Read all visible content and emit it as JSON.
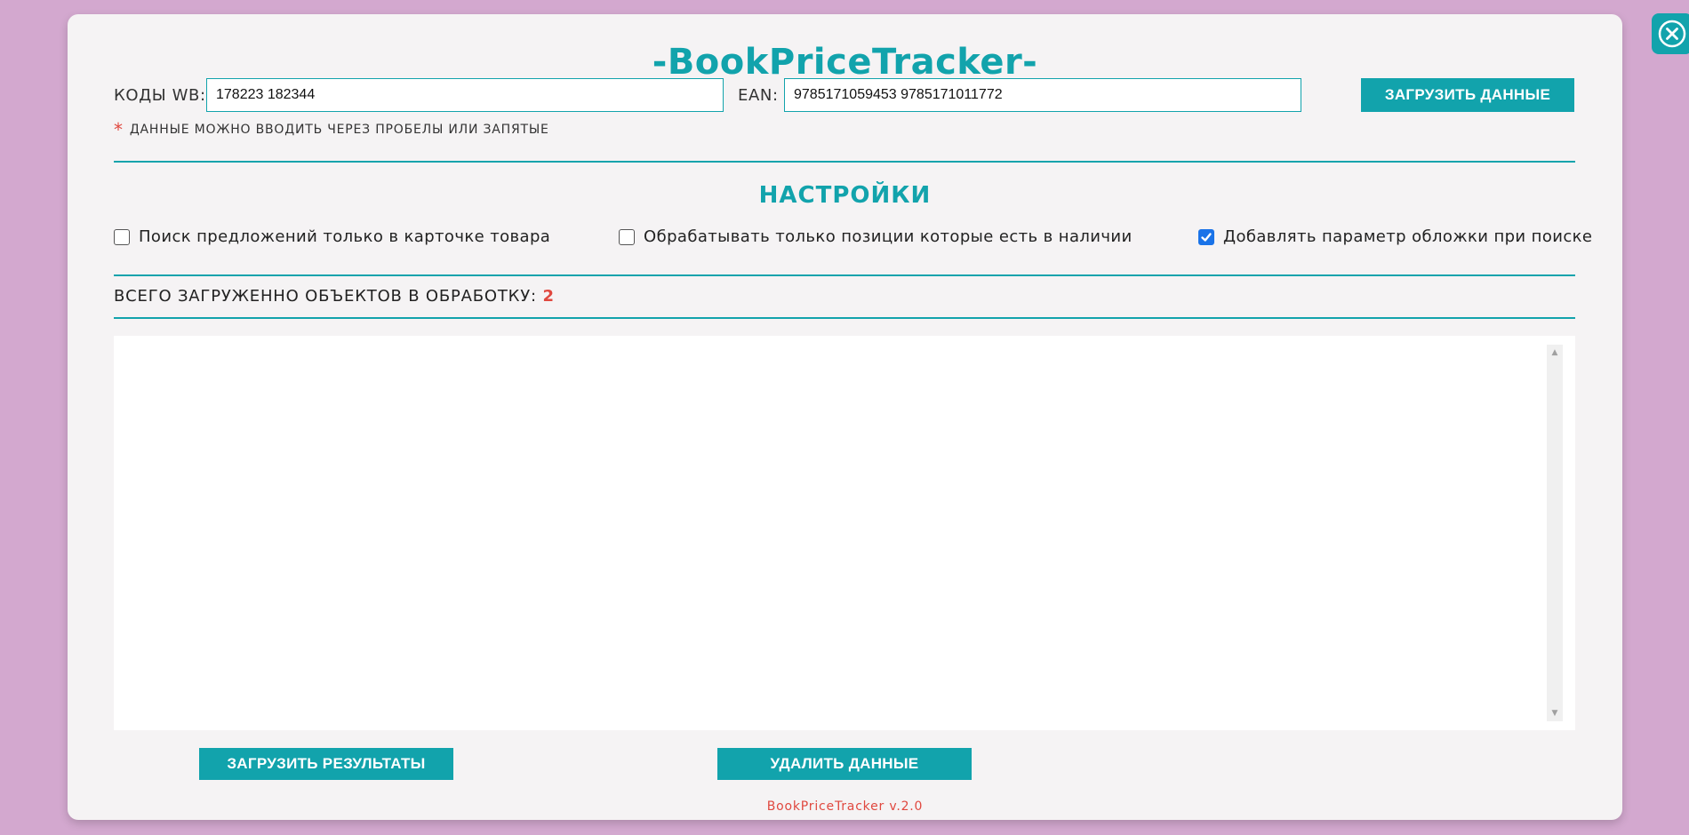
{
  "app": {
    "title": "-BookPriceTracker-",
    "footer": "BookPriceTracker v.2.0"
  },
  "inputs": {
    "wb_label": "КОДЫ WB:",
    "wb_value": "178223 182344",
    "ean_label": "EAN:",
    "ean_value": "9785171059453 9785171011772",
    "load_button": "ЗАГРУЗИТЬ ДАННЫЕ",
    "hint_star": "*",
    "hint": "ДАННЫЕ МОЖНО ВВОДИТЬ ЧЕРЕЗ ПРОБЕЛЫ ИЛИ ЗАПЯТЫЕ"
  },
  "settings": {
    "title": "НАСТРОЙКИ",
    "options": [
      {
        "label": "Поиск предложений только в карточке товара",
        "checked": false
      },
      {
        "label": "Обрабатывать только позиции которые есть в наличии",
        "checked": false
      },
      {
        "label": "Добавлять параметр обложки при поиске",
        "checked": true
      }
    ]
  },
  "status": {
    "total_label": "ВСЕГО ЗАГРУЖЕННО ОБЪЕКТОВ В ОБРАБОТКУ:",
    "total_count": "2"
  },
  "actions": {
    "download_results": "ЗАГРУЗИТЬ РЕЗУЛЬТАТЫ",
    "delete_data": "УДАЛИТЬ ДАННЫЕ"
  },
  "icons": {
    "close": "close-icon",
    "checkmark": "checkmark-icon",
    "scroll_up": "scroll-up-arrow-icon",
    "scroll_down": "scroll-down-arrow-icon"
  },
  "colors": {
    "accent": "#12a3ac",
    "background": "#d3a8cf",
    "panel": "#f5f3f4",
    "highlight": "#e0483f",
    "checkbox_checked": "#1a73e8"
  }
}
